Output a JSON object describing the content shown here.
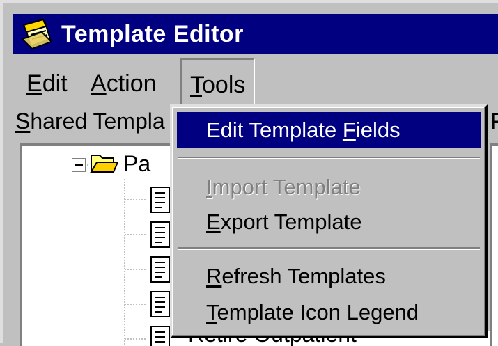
{
  "window": {
    "title": "Template Editor",
    "icon": "notepad-icon"
  },
  "menubar": {
    "items": [
      {
        "label": "Edit",
        "mnemonic": "E"
      },
      {
        "label": "Action",
        "mnemonic": "A"
      },
      {
        "label": "Tools",
        "mnemonic": "T"
      }
    ]
  },
  "panes": {
    "shared_label": "Shared Templa",
    "right_label_partial": "F"
  },
  "tree": {
    "root_label": "Pa",
    "template_count": 5
  },
  "bottom_partial_text": "Retire Outpatient",
  "tools_menu": {
    "edit_fields": {
      "text": "Edit Template Fields",
      "before": "Edit Template ",
      "mnemonic": "F",
      "after": "ields"
    },
    "import": {
      "text": "Import Template",
      "mnemonic": "I",
      "after": "mport Template"
    },
    "export": {
      "text": "Export Template",
      "mnemonic": "E",
      "after": "xport Template"
    },
    "refresh": {
      "text": "Refresh Templates",
      "mnemonic": "R",
      "after": "efresh Templates"
    },
    "legend": {
      "text": "Template Icon Legend",
      "mnemonic": "T",
      "after": "emplate Icon Legend"
    }
  },
  "colors": {
    "titlebar": "#000080",
    "selection": "#000080",
    "face": "#c0c0c0"
  }
}
